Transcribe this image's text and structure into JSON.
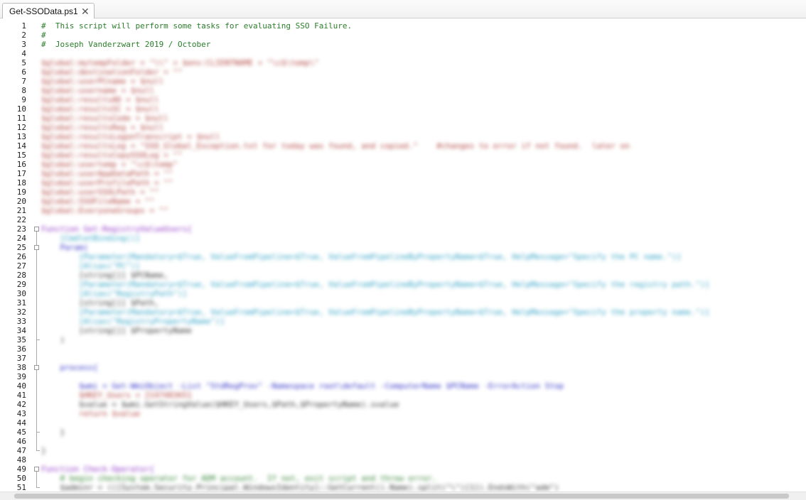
{
  "tab": {
    "title": "Get-SSOData.ps1",
    "close_glyph": "✕"
  },
  "lines": [
    {
      "n": "1",
      "text": "#  This script will perform some tasks for evaluating SSO Failure.",
      "kind": "comment",
      "blur": false
    },
    {
      "n": "2",
      "text": "#",
      "kind": "comment",
      "blur": false
    },
    {
      "n": "3",
      "text": "#  Joseph Vanderzwart 2019 / October",
      "kind": "comment",
      "blur": false
    },
    {
      "n": "4",
      "text": "",
      "kind": "plain",
      "blur": false
    },
    {
      "n": "5",
      "text": "$global:mytempFolder = \"\\\\\" + $env:CLIENTNAME + \"\\c$\\temp\\\"",
      "kind": "var",
      "blur": true
    },
    {
      "n": "6",
      "text": "$global:destinationFolder = \"\"",
      "kind": "var",
      "blur": true
    },
    {
      "n": "7",
      "text": "$global:userPCname = $null",
      "kind": "var",
      "blur": true
    },
    {
      "n": "8",
      "text": "$global:username = $null",
      "kind": "var",
      "blur": true
    },
    {
      "n": "9",
      "text": "$global:resultsAD = $null",
      "kind": "var",
      "blur": true
    },
    {
      "n": "10",
      "text": "$global:resultsSC = $null",
      "kind": "var",
      "blur": true
    },
    {
      "n": "11",
      "text": "$global:resultsCode = $null",
      "kind": "var",
      "blur": true
    },
    {
      "n": "12",
      "text": "$global:resultsReg = $null",
      "kind": "var",
      "blur": true
    },
    {
      "n": "13",
      "text": "$global:resultsLogonTranscript = $null",
      "kind": "var",
      "blur": true
    },
    {
      "n": "14",
      "text": "$global:resultsLog = \"SSO_Global_Exception.txt for today was found, and copied.\"    #changes to error if not found.  later on",
      "kind": "var",
      "blur": true
    },
    {
      "n": "15",
      "text": "$global:resultsCopySSOLog = \"\"",
      "kind": "var",
      "blur": true
    },
    {
      "n": "16",
      "text": "$global:usertemp = \"\\c$\\temp\"",
      "kind": "var",
      "blur": true
    },
    {
      "n": "17",
      "text": "$global:userAppDataPath = \"\"",
      "kind": "var",
      "blur": true
    },
    {
      "n": "18",
      "text": "$global:userProfilePath = \"\"",
      "kind": "var",
      "blur": true
    },
    {
      "n": "19",
      "text": "$global:userSSOLPath = \"\"",
      "kind": "var",
      "blur": true
    },
    {
      "n": "20",
      "text": "$global:SSOFileName = \"\"",
      "kind": "var",
      "blur": true
    },
    {
      "n": "21",
      "text": "$global:EveryoneGroups = \"\"",
      "kind": "var",
      "blur": true
    },
    {
      "n": "22",
      "text": "",
      "kind": "plain",
      "blur": false
    },
    {
      "n": "23",
      "text": "Function Get-RegistryValueUsers{",
      "kind": "fn",
      "blur": true
    },
    {
      "n": "24",
      "text": "    [CmdletBinding()]",
      "kind": "type",
      "blur": true
    },
    {
      "n": "25",
      "text": "    Param(",
      "kind": "kw",
      "blur": true
    },
    {
      "n": "26",
      "text": "        [Parameter(Mandatory=$True, ValueFromPipeline=$True, ValueFromPipelineByPropertyName=$True, HelpMessage=\"Specify the PC name.\")]",
      "kind": "type",
      "blur": true
    },
    {
      "n": "27",
      "text": "        [Alias(\"PC\")]",
      "kind": "type",
      "blur": true
    },
    {
      "n": "28",
      "text": "        [string[]] $PCName,",
      "kind": "plain",
      "blur": true
    },
    {
      "n": "29",
      "text": "        [Parameter(Mandatory=$True, ValueFromPipeline=$True, ValueFromPipelineByPropertyName=$True, HelpMessage=\"Specify the registry path.\")]",
      "kind": "type",
      "blur": true
    },
    {
      "n": "30",
      "text": "        [Alias(\"RegistryPath\")]",
      "kind": "type",
      "blur": true
    },
    {
      "n": "31",
      "text": "        [string[]] $Path,",
      "kind": "plain",
      "blur": true
    },
    {
      "n": "32",
      "text": "        [Parameter(Mandatory=$True, ValueFromPipeline=$True, ValueFromPipelineByPropertyName=$True, HelpMessage=\"Specify the property name.\")]",
      "kind": "type",
      "blur": true
    },
    {
      "n": "33",
      "text": "        [Alias(\"RegistryPropertyName\")]",
      "kind": "type",
      "blur": true
    },
    {
      "n": "34",
      "text": "        [string[]] $PropertyName",
      "kind": "plain",
      "blur": true
    },
    {
      "n": "35",
      "text": "    )",
      "kind": "plain",
      "blur": true
    },
    {
      "n": "36",
      "text": "",
      "kind": "plain",
      "blur": false
    },
    {
      "n": "37",
      "text": "",
      "kind": "plain",
      "blur": false
    },
    {
      "n": "38",
      "text": "    process{",
      "kind": "kw",
      "blur": true
    },
    {
      "n": "39",
      "text": "",
      "kind": "plain",
      "blur": false
    },
    {
      "n": "40",
      "text": "        $wmi = Get-WmiObject -List \"StdRegProv\" -Namespace root\\default -ComputerName $PCName -ErrorAction Stop",
      "kind": "kw",
      "blur": true
    },
    {
      "n": "41",
      "text": "        $HKEY_Users = 2147483651",
      "kind": "var",
      "blur": true
    },
    {
      "n": "42",
      "text": "        $value = $wmi.GetStringValue($HKEY_Users,$Path,$PropertyName).svalue",
      "kind": "plain",
      "blur": true
    },
    {
      "n": "43",
      "text": "        return $value",
      "kind": "var",
      "blur": true
    },
    {
      "n": "44",
      "text": "",
      "kind": "plain",
      "blur": false
    },
    {
      "n": "45",
      "text": "    }",
      "kind": "plain",
      "blur": true
    },
    {
      "n": "46",
      "text": "",
      "kind": "plain",
      "blur": false
    },
    {
      "n": "47",
      "text": "}",
      "kind": "plain",
      "blur": true
    },
    {
      "n": "48",
      "text": "",
      "kind": "plain",
      "blur": false
    },
    {
      "n": "49",
      "text": "Function Check-Operator{",
      "kind": "fn",
      "blur": true
    },
    {
      "n": "50",
      "text": "    # begin checking operator for ADM account.  If not, exit script and throw error.",
      "kind": "comment",
      "blur": true
    },
    {
      "n": "51",
      "text": "    $adminr = (([System.Security.Principal.WindowsIdentity]::GetCurrent().Name).split(\"\\\")[1]).EndsWith(\"adm\")",
      "kind": "plain",
      "blur": true
    }
  ],
  "folds": [
    {
      "start": "23",
      "end": "47"
    },
    {
      "start": "25",
      "end": "35"
    },
    {
      "start": "38",
      "end": "45"
    },
    {
      "start": "49",
      "end": "51"
    }
  ],
  "colors": {
    "comment": "#2b7d2b",
    "variable": "#b0423d",
    "keyword": "#2c2cc8",
    "function": "#8f32c5",
    "type": "#2aa0c4"
  }
}
